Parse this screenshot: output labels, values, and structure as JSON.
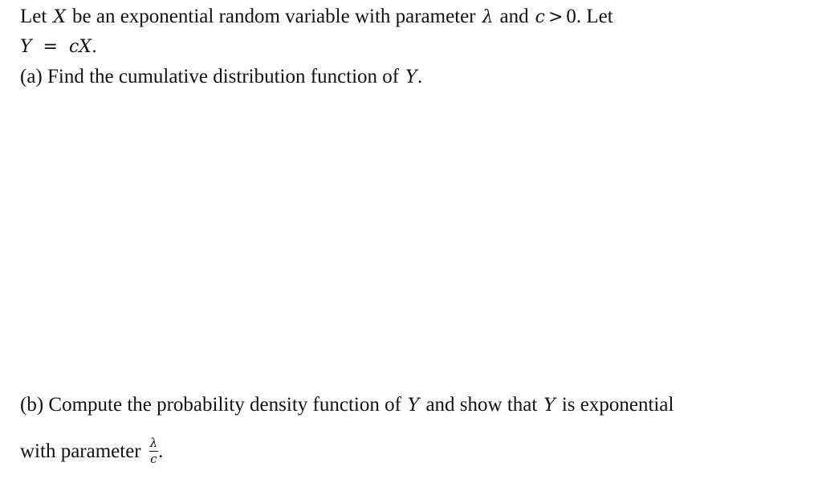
{
  "problem": {
    "intro": {
      "t1": "Let",
      "X": "X",
      "t2": "be an exponential random variable with parameter",
      "lambda": "λ",
      "t3": "and",
      "c": "c",
      "gt": ">",
      "t4": "0. Let"
    },
    "definition": {
      "Y": "Y",
      "eq": "=",
      "cX": "cX",
      "period": "."
    },
    "part_a": {
      "text": "(a) Find the cumulative distribution function of",
      "Y": "Y",
      "period": "."
    },
    "part_b": {
      "t1": "(b) Compute the probability density function of",
      "Y1": "Y",
      "t2": "and show that",
      "Y2": "Y",
      "t3": "is exponential",
      "t4": "with parameter",
      "frac_num": "λ",
      "frac_den": "c",
      "period": "."
    }
  }
}
